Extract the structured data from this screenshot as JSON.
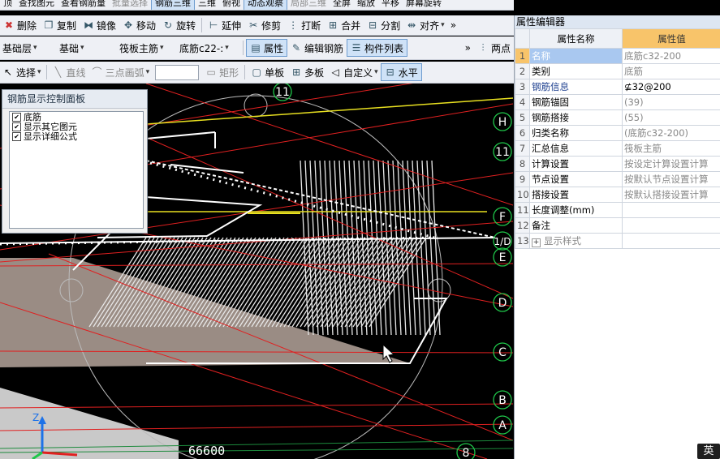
{
  "toolbar_row1": {
    "items": [
      "查找图元",
      "查看钢筋量",
      "批量选择",
      "钢筋三维",
      "三维",
      "俯视",
      "动态观察",
      "局部三维",
      "全屏",
      "缩放",
      "平移",
      "屏幕旋转"
    ],
    "left_glyph": "顶"
  },
  "toolbar_row2": {
    "delete": "删除",
    "copy": "复制",
    "mirror": "镜像",
    "move": "移动",
    "rotate": "旋转",
    "extend": "延伸",
    "trim": "修剪",
    "break": "打断",
    "merge": "合并",
    "split": "分割",
    "align": "对齐",
    "more": "»"
  },
  "toolbar_row3": {
    "layer": "基础层",
    "category": "基础",
    "component_type": "筏板主筋",
    "component": "底筋c22-:",
    "properties": "属性",
    "edit_rebar": "编辑钢筋",
    "component_list": "构件列表",
    "two_points": "两点",
    "more": "»"
  },
  "toolbar_row4": {
    "select": "选择",
    "line": "直线",
    "three_point_arc": "三点画弧",
    "rectangle": "矩形",
    "single_board": "单板",
    "multi_board": "多板",
    "custom": "自定义",
    "horizontal": "水平"
  },
  "rebar_panel": {
    "title": "钢筋显示控制面板",
    "items": [
      {
        "label": "底筋",
        "checked": true
      },
      {
        "label": "显示其它图元",
        "checked": true
      },
      {
        "label": "显示详细公式",
        "checked": true
      }
    ]
  },
  "canvas": {
    "axis_labels": [
      "11",
      "H",
      "11",
      "F",
      "1/D",
      "E",
      "D",
      "C",
      "B",
      "A",
      "8"
    ],
    "dimension": "66600",
    "axis_z": "Z"
  },
  "property_editor": {
    "title": "属性编辑器",
    "col_name": "属性名称",
    "col_value": "属性值",
    "rows": [
      {
        "num": "1",
        "name": "名称",
        "value": "底筋c32-200"
      },
      {
        "num": "2",
        "name": "类别",
        "value": "底筋"
      },
      {
        "num": "3",
        "name": "钢筋信息",
        "value": "⊈32@200"
      },
      {
        "num": "4",
        "name": "钢筋锚固",
        "value": "(39)"
      },
      {
        "num": "5",
        "name": "钢筋搭接",
        "value": "(55)"
      },
      {
        "num": "6",
        "name": "归类名称",
        "value": "(底筋c32-200)"
      },
      {
        "num": "7",
        "name": "汇总信息",
        "value": "筏板主筋"
      },
      {
        "num": "8",
        "name": "计算设置",
        "value": "按设定计算设置计算"
      },
      {
        "num": "9",
        "name": "节点设置",
        "value": "按默认节点设置计算"
      },
      {
        "num": "10",
        "name": "搭接设置",
        "value": "按默认搭接设置计算"
      },
      {
        "num": "11",
        "name": "长度调整(mm)",
        "value": ""
      },
      {
        "num": "12",
        "name": "备注",
        "value": ""
      },
      {
        "num": "13",
        "name": "显示样式",
        "value": ""
      }
    ]
  },
  "ime": "英"
}
